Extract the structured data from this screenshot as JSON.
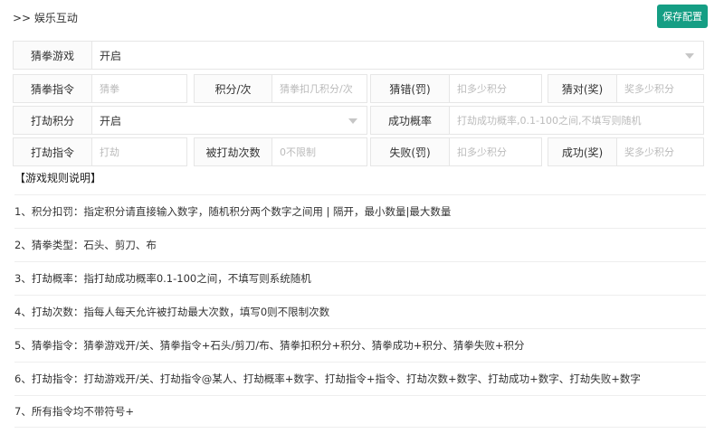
{
  "header": {
    "title": ">> 娱乐互动",
    "save_label": "保存配置"
  },
  "rows": {
    "game": {
      "label": "猜拳游戏",
      "value": "开启"
    },
    "guess": {
      "cmd_label": "猜拳指令",
      "cmd_placeholder": "猜拳",
      "points_label": "积分/次",
      "points_placeholder": "猜拳扣几积分/次",
      "wrong_label": "猜错(罚)",
      "wrong_placeholder": "扣多少积分",
      "right_label": "猜对(奖)",
      "right_placeholder": "奖多少积分"
    },
    "rob": {
      "label": "打劫积分",
      "value": "开启",
      "prob_label": "成功概率",
      "prob_placeholder": "打劫成功概率,0.1-100之间,不填写则随机"
    },
    "robcmd": {
      "cmd_label": "打劫指令",
      "cmd_placeholder": "打劫",
      "times_label": "被打劫次数",
      "times_placeholder": "0不限制",
      "fail_label": "失败(罚)",
      "fail_placeholder": "扣多少积分",
      "success_label": "成功(奖)",
      "success_placeholder": "奖多少积分"
    }
  },
  "rules": {
    "title": "【游戏规则说明】",
    "items": [
      "1、积分扣罚：指定积分请直接输入数字，随机积分两个数字之间用 | 隔开，最小数量|最大数量",
      "2、猜拳类型：石头、剪刀、布",
      "3、打劫概率：指打劫成功概率0.1-100之间，不填写则系统随机",
      "4、打劫次数：指每人每天允许被打劫最大次数，填写0则不限制次数",
      "5、猜拳指令：猜拳游戏开/关、猜拳指令+石头/剪刀/布、猜拳扣积分+积分、猜拳成功+积分、猜拳失败+积分",
      "6、打劫指令：打劫游戏开/关、打劫指令@某人、打劫概率+数字、打劫指令+指令、打劫次数+数字、打劫成功+数字、打劫失败+数字",
      "7、所有指令均不带符号+"
    ]
  }
}
